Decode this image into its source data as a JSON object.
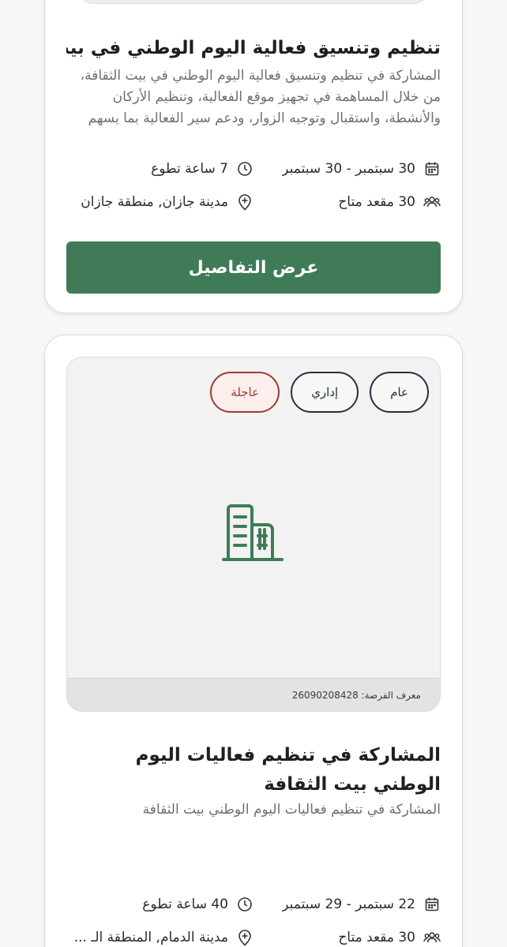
{
  "cards": [
    {
      "title": "تنظيم وتنسيق فعالية اليوم الوطني في بيت الثقافة",
      "description": "المشاركة في تنظيم وتنسيق فعالية اليوم الوطني في بيت الثقافة، من خلال المساهمة في تجهيز موقع الفعالية، وتنظيم الأركان والأنشطة، واستقبال وتوجيه الزوار، ودعم سير الفعالية بما يسهم في إنجاحها...",
      "date_range": "30 سبتمبر - 30 سبتمبر",
      "hours": "7 ساعة تطوع",
      "seats": "30 مقعد متاح",
      "location": "مدينة جازان, منطقة جازان",
      "button_label": "عرض التفاصيل"
    },
    {
      "tags": [
        "عام",
        "إداري",
        "عاجلة"
      ],
      "opportunity_id": "معرف الفرصة: 26090208428",
      "title": "المشاركة في تنظيم فعاليات اليوم الوطني بيت الثقافة",
      "description": "المشاركة في تنظيم فعاليات اليوم الوطني بيت الثقافة",
      "date_range": "22 سبتمبر - 29 سبتمبر",
      "hours": "40 ساعة تطوع",
      "seats": "30 مقعد متاح",
      "location": "مدينة الدمام, المنطقة الـ ..."
    }
  ],
  "icons": {
    "calendar": "calendar-icon",
    "clock": "clock-icon",
    "users": "users-icon",
    "location": "location-pin-icon",
    "building": "building-icon"
  },
  "colors": {
    "primary_green": "#3f7b57",
    "urgent_red": "#9e3b32",
    "tag_navy": "#243041"
  }
}
